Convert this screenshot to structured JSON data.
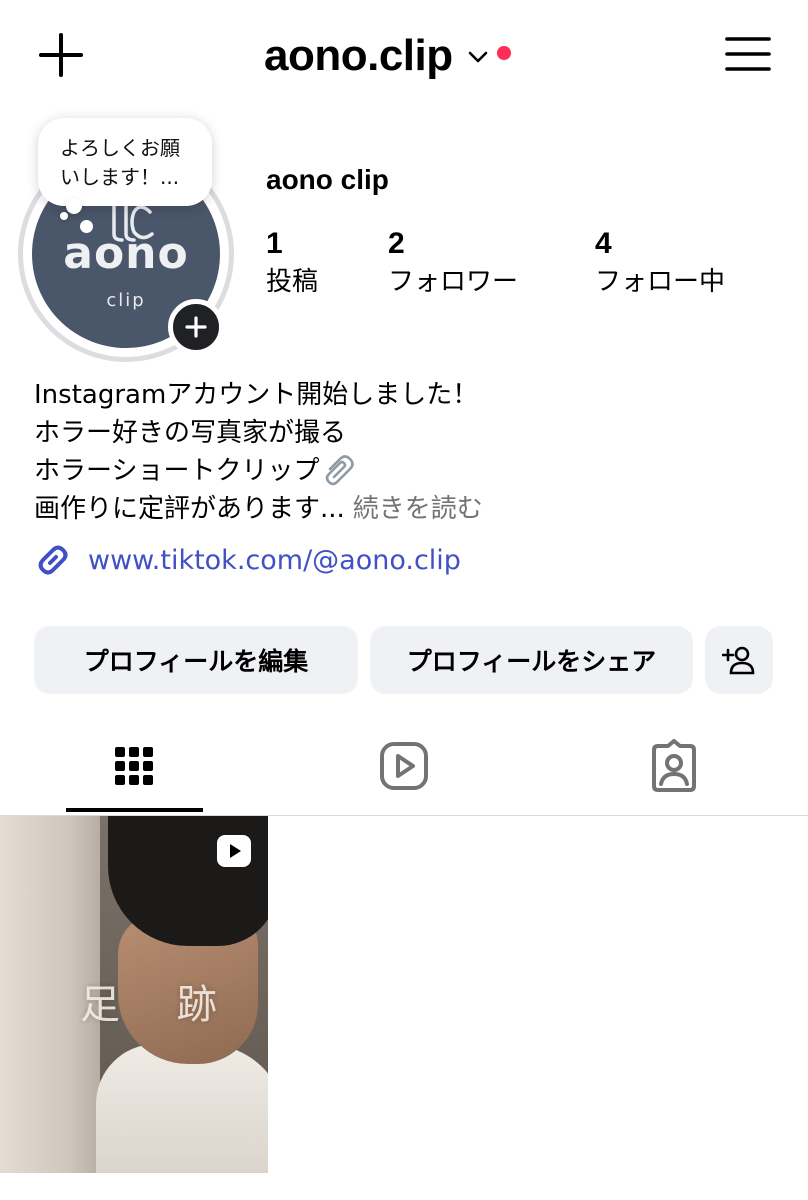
{
  "header": {
    "username": "aono.clip"
  },
  "colors": {
    "notification_dot": "#ff2d55",
    "link": "#4150c6",
    "button_bg": "#eff1f4",
    "avatar_bg": "#4a5669",
    "secondary_text": "#737373"
  },
  "profile": {
    "avatar": {
      "text": "aono",
      "subtext": "clip"
    },
    "note": {
      "line1": "よろしくお願",
      "line2": "いします！..."
    },
    "display_name": "aono clip",
    "stats": {
      "posts": {
        "value": "1",
        "label": "投稿"
      },
      "followers": {
        "value": "2",
        "label": "フォロワー"
      },
      "following": {
        "value": "4",
        "label": "フォロー中"
      }
    },
    "bio": {
      "line1": "Instagramアカウント開始しました！",
      "line2": "ホラー好きの写真家が撮る",
      "line3": "ホラーショートクリップ",
      "line4": "画作りに定評があります...",
      "more": "続きを読む"
    },
    "link": "www.tiktok.com/@aono.clip"
  },
  "actions": {
    "edit_profile": "プロフィールを編集",
    "share_profile": "プロフィールをシェア"
  },
  "tabs": [
    {
      "name": "grid",
      "icon": "grid-icon",
      "active": true
    },
    {
      "name": "reels",
      "icon": "reels-icon",
      "active": false
    },
    {
      "name": "tagged",
      "icon": "tagged-icon",
      "active": false
    }
  ],
  "posts": [
    {
      "type": "reel",
      "overlay_text": "足 跡"
    }
  ]
}
